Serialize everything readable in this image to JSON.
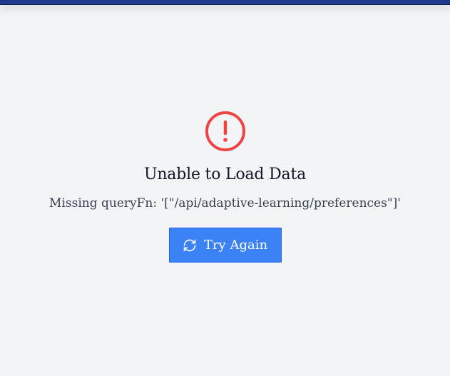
{
  "error": {
    "icon": "alert-circle-icon",
    "title": "Unable to Load Data",
    "message": "Missing queryFn: '[\"/api/adaptive-learning/preferences\"]'",
    "retry_label": "Try Again",
    "retry_icon": "refresh-icon"
  },
  "colors": {
    "background": "#f3f4f6",
    "top_bar": "#1f3a8a",
    "error_red": "#ef4444",
    "button_blue": "#3b82f6",
    "title_text": "#111827",
    "message_text": "#374151"
  }
}
